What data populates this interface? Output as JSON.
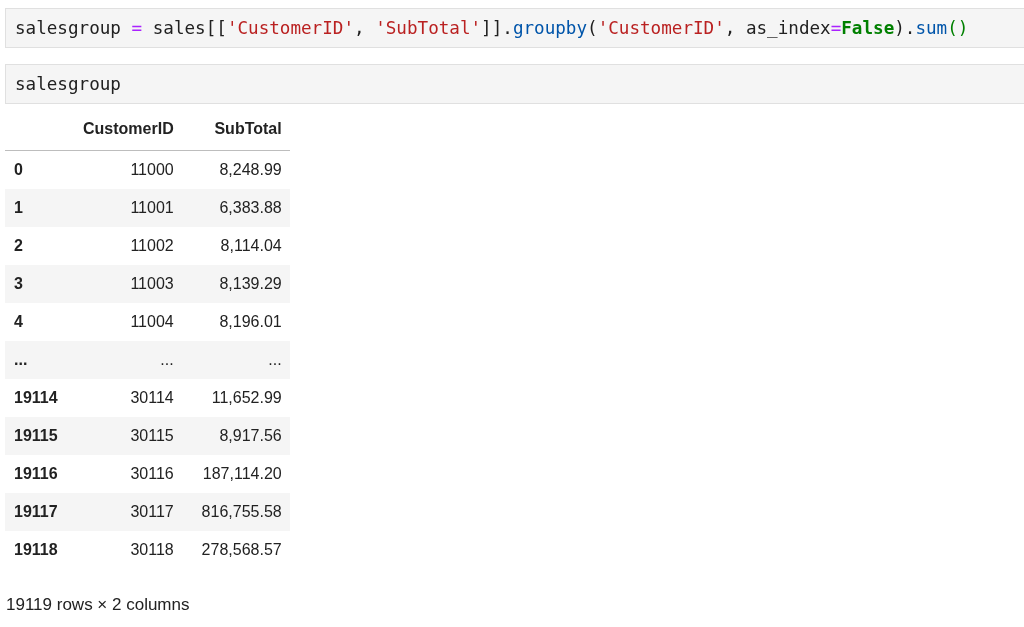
{
  "cells": [
    {
      "kind": "code",
      "tokens": [
        {
          "kind": "plain",
          "text": "salesgroup "
        },
        {
          "kind": "operator",
          "text": "="
        },
        {
          "kind": "plain",
          "text": " sales[["
        },
        {
          "kind": "string",
          "text": "'CustomerID'"
        },
        {
          "kind": "plain",
          "text": ", "
        },
        {
          "kind": "string",
          "text": "'SubTotal'"
        },
        {
          "kind": "plain",
          "text": "]]."
        },
        {
          "kind": "call",
          "text": "groupby"
        },
        {
          "kind": "plain",
          "text": "("
        },
        {
          "kind": "string",
          "text": "'CustomerID'"
        },
        {
          "kind": "plain",
          "text": ", as_index"
        },
        {
          "kind": "operator",
          "text": "="
        },
        {
          "kind": "keyword",
          "text": "False"
        },
        {
          "kind": "plain",
          "text": ")."
        },
        {
          "kind": "call",
          "text": "sum"
        },
        {
          "kind": "bracket",
          "text": "()"
        }
      ]
    },
    {
      "kind": "code",
      "tokens": [
        {
          "kind": "plain",
          "text": "salesgroup"
        }
      ]
    }
  ],
  "dataframe": {
    "columns": [
      "",
      "CustomerID",
      "SubTotal"
    ],
    "rows": [
      [
        "0",
        "11000",
        "8,248.99"
      ],
      [
        "1",
        "11001",
        "6,383.88"
      ],
      [
        "2",
        "11002",
        "8,114.04"
      ],
      [
        "3",
        "11003",
        "8,139.29"
      ],
      [
        "4",
        "11004",
        "8,196.01"
      ],
      [
        "...",
        "...",
        "..."
      ],
      [
        "19114",
        "30114",
        "11,652.99"
      ],
      [
        "19115",
        "30115",
        "8,917.56"
      ],
      [
        "19116",
        "30116",
        "187,114.20"
      ],
      [
        "19117",
        "30117",
        "816,755.58"
      ],
      [
        "19118",
        "30118",
        "278,568.57"
      ]
    ],
    "footer": "19119 rows × 2 columns"
  }
}
